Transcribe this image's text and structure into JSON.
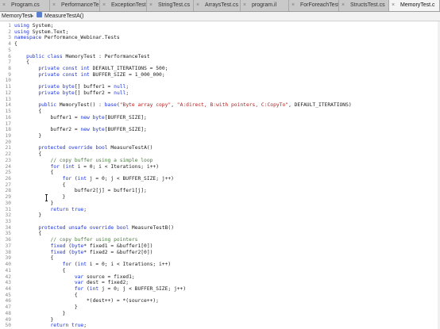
{
  "tabs": [
    {
      "label": "Program.cs",
      "active": false
    },
    {
      "label": "PerformanceTe",
      "active": false
    },
    {
      "label": "ExceptionTest.c",
      "active": false
    },
    {
      "label": "StringTest.cs",
      "active": false
    },
    {
      "label": "ArraysTest.cs",
      "active": false
    },
    {
      "label": "program.il",
      "active": false
    },
    {
      "label": "ForForeachTest",
      "active": false
    },
    {
      "label": "StructsTest.cs",
      "active": false
    },
    {
      "label": "MemoryTest.c",
      "active": true
    }
  ],
  "breadcrumb": {
    "class_label": "MemoryTest",
    "method_label": "MeasureTestA()"
  },
  "code_lines": [
    {
      "n": "1",
      "t": "using System;"
    },
    {
      "n": "2",
      "t": "using System.Text;"
    },
    {
      "n": "3",
      "t": "namespace Performance_Webinar.Tests"
    },
    {
      "n": "4",
      "t": "{"
    },
    {
      "n": "5",
      "t": ""
    },
    {
      "n": "6",
      "t": "    public class MemoryTest : PerformanceTest"
    },
    {
      "n": "7",
      "t": "    {"
    },
    {
      "n": "8",
      "t": "        private const int DEFAULT_ITERATIONS = 500;"
    },
    {
      "n": "9",
      "t": "        private const int BUFFER_SIZE = 1_000_000;"
    },
    {
      "n": "10",
      "t": ""
    },
    {
      "n": "11",
      "t": "        private byte[] buffer1 = null;"
    },
    {
      "n": "12",
      "t": "        private byte[] buffer2 = null;"
    },
    {
      "n": "13",
      "t": ""
    },
    {
      "n": "14",
      "t": "        public MemoryTest() : base(\"Byte array copy\", \"A:direct, B:with pointers, C:CopyTo\", DEFAULT_ITERATIONS)"
    },
    {
      "n": "15",
      "t": "        {"
    },
    {
      "n": "16",
      "t": "            buffer1 = new byte[BUFFER_SIZE];"
    },
    {
      "n": "17",
      "t": ""
    },
    {
      "n": "18",
      "t": "            buffer2 = new byte[BUFFER_SIZE];"
    },
    {
      "n": "19",
      "t": "        }"
    },
    {
      "n": "20",
      "t": ""
    },
    {
      "n": "21",
      "t": "        protected override bool MeasureTestA()"
    },
    {
      "n": "22",
      "t": "        {"
    },
    {
      "n": "23",
      "t": "            // copy buffer using a simple loop"
    },
    {
      "n": "24",
      "t": "            for (int i = 0; i < Iterations; i++)"
    },
    {
      "n": "25",
      "t": "            {"
    },
    {
      "n": "26",
      "t": "                for (int j = 0; j < BUFFER_SIZE; j++)"
    },
    {
      "n": "27",
      "t": "                {"
    },
    {
      "n": "28",
      "t": "                    buffer2[j] = buffer1[j];"
    },
    {
      "n": "29",
      "t": "                }"
    },
    {
      "n": "30",
      "t": "            }"
    },
    {
      "n": "31",
      "t": "            return true;"
    },
    {
      "n": "32",
      "t": "        }"
    },
    {
      "n": "33",
      "t": ""
    },
    {
      "n": "34",
      "t": "        protected unsafe override bool MeasureTestB()"
    },
    {
      "n": "35",
      "t": "        {"
    },
    {
      "n": "36",
      "t": "            // copy buffer using pointers"
    },
    {
      "n": "37",
      "t": "            fixed (byte* fixed1 = &buffer1[0])"
    },
    {
      "n": "38",
      "t": "            fixed (byte* fixed2 = &buffer2[0])"
    },
    {
      "n": "39",
      "t": "            {"
    },
    {
      "n": "40",
      "t": "                for (int i = 0; i < Iterations; i++)"
    },
    {
      "n": "41",
      "t": "                {"
    },
    {
      "n": "42",
      "t": "                    var source = fixed1;"
    },
    {
      "n": "43",
      "t": "                    var dest = fixed2;"
    },
    {
      "n": "44",
      "t": "                    for (int j = 0; j < BUFFER_SIZE; j++)"
    },
    {
      "n": "45",
      "t": "                    {"
    },
    {
      "n": "46",
      "t": "                        *(dest++) = *(source++);"
    },
    {
      "n": "47",
      "t": "                    }"
    },
    {
      "n": "48",
      "t": "                }"
    },
    {
      "n": "49",
      "t": "            }"
    },
    {
      "n": "50",
      "t": "            return true;"
    }
  ],
  "colors": {
    "keyword": "#1c34d6",
    "string": "#b31f1f",
    "comment": "#4a7a3f",
    "text": "#1a1a1a",
    "line_number": "#8a8a8a"
  }
}
